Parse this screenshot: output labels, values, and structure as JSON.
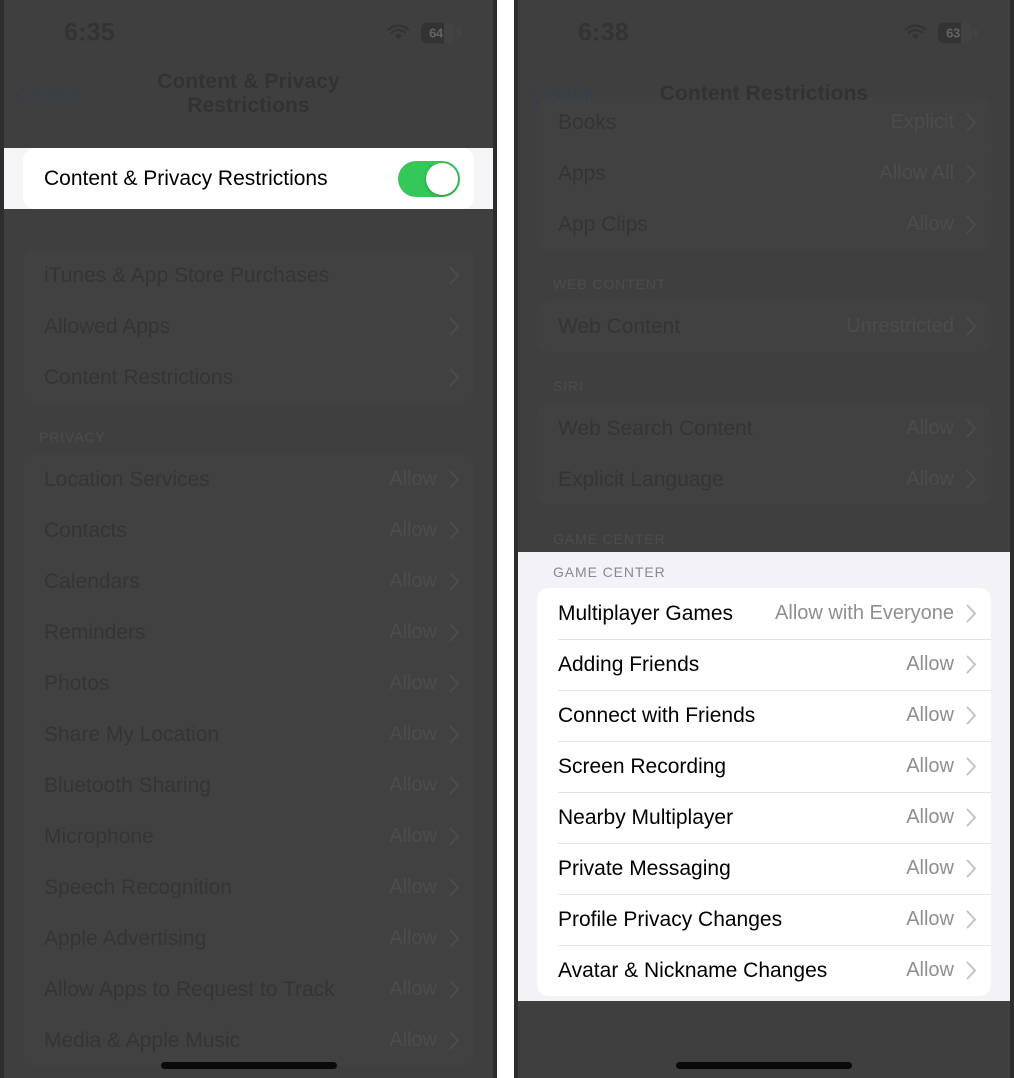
{
  "left_phone": {
    "status": {
      "time": "6:35",
      "battery": "64",
      "wifi_icon": "wifi-icon"
    },
    "nav": {
      "back_label": "Back",
      "title": "Content & Privacy Restrictions"
    },
    "highlight_row": {
      "label": "Content & Privacy Restrictions",
      "toggle_state": "on",
      "toggle_color": "#34C759"
    },
    "groups": [
      {
        "header": "",
        "rows": [
          {
            "label": "iTunes & App Store Purchases",
            "value": ""
          },
          {
            "label": "Allowed Apps",
            "value": ""
          },
          {
            "label": "Content Restrictions",
            "value": ""
          }
        ]
      },
      {
        "header": "PRIVACY",
        "rows": [
          {
            "label": "Location Services",
            "value": "Allow"
          },
          {
            "label": "Contacts",
            "value": "Allow"
          },
          {
            "label": "Calendars",
            "value": "Allow"
          },
          {
            "label": "Reminders",
            "value": "Allow"
          },
          {
            "label": "Photos",
            "value": "Allow"
          },
          {
            "label": "Share My Location",
            "value": "Allow"
          },
          {
            "label": "Bluetooth Sharing",
            "value": "Allow"
          },
          {
            "label": "Microphone",
            "value": "Allow"
          },
          {
            "label": "Speech Recognition",
            "value": "Allow"
          },
          {
            "label": "Apple Advertising",
            "value": "Allow"
          },
          {
            "label": "Allow Apps to Request to Track",
            "value": "Allow"
          },
          {
            "label": "Media & Apple Music",
            "value": "Allow"
          }
        ]
      }
    ]
  },
  "right_phone": {
    "status": {
      "time": "6:38",
      "battery": "63",
      "wifi_icon": "wifi-icon"
    },
    "nav": {
      "back_label": "Back",
      "title": "Content Restrictions"
    },
    "groups": [
      {
        "header": "",
        "rows": [
          {
            "label": "Books",
            "value": "Explicit"
          },
          {
            "label": "Apps",
            "value": "Allow All"
          },
          {
            "label": "App Clips",
            "value": "Allow"
          }
        ]
      },
      {
        "header": "WEB CONTENT",
        "rows": [
          {
            "label": "Web Content",
            "value": "Unrestricted"
          }
        ]
      },
      {
        "header": "SIRI",
        "rows": [
          {
            "label": "Web Search Content",
            "value": "Allow"
          },
          {
            "label": "Explicit Language",
            "value": "Allow"
          }
        ]
      }
    ],
    "highlight_group": {
      "header": "GAME CENTER",
      "rows": [
        {
          "label": "Multiplayer Games",
          "value": "Allow with Everyone"
        },
        {
          "label": "Adding Friends",
          "value": "Allow"
        },
        {
          "label": "Connect with Friends",
          "value": "Allow"
        },
        {
          "label": "Screen Recording",
          "value": "Allow"
        },
        {
          "label": "Nearby Multiplayer",
          "value": "Allow"
        },
        {
          "label": "Private Messaging",
          "value": "Allow"
        },
        {
          "label": "Profile Privacy Changes",
          "value": "Allow"
        },
        {
          "label": "Avatar & Nickname Changes",
          "value": "Allow"
        }
      ]
    }
  }
}
